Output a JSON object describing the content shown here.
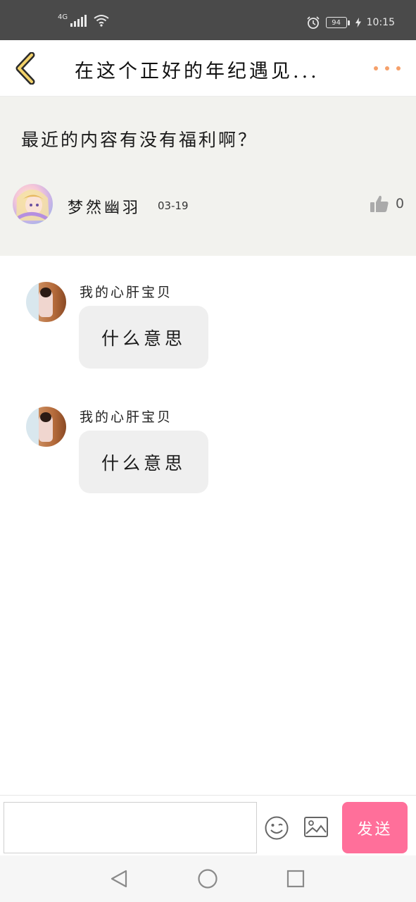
{
  "status_bar": {
    "network": "4G",
    "battery": "94",
    "time": "10:15"
  },
  "header": {
    "title": "在这个正好的年纪遇见...",
    "back_icon": "chevron-left-icon",
    "more_icon": "more-dots-icon",
    "accent_color": "#f5a06a"
  },
  "post": {
    "question": "最近的内容有没有福利啊？",
    "author": "梦然幽羽",
    "date": "03-19",
    "like_icon": "thumbs-up-icon",
    "likes": "0"
  },
  "comments": [
    {
      "name": "我的心肝宝贝",
      "text": "什么意思"
    },
    {
      "name": "我的心肝宝贝",
      "text": "什么意思"
    }
  ],
  "input_bar": {
    "placeholder": "",
    "emoji_icon": "emoji-icon",
    "image_icon": "image-icon",
    "send_label": "发送",
    "send_color": "#ff6f9a"
  },
  "nav_bar": {
    "back_icon": "nav-back-icon",
    "home_icon": "nav-home-icon",
    "recents_icon": "nav-recents-icon"
  }
}
